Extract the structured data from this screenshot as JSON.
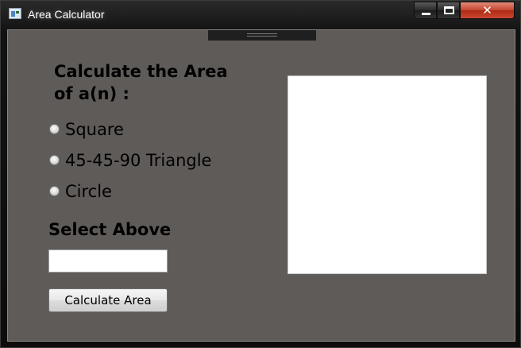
{
  "window": {
    "title": "Area Calculator",
    "close_glyph": "✕"
  },
  "main": {
    "heading": "Calculate the Area of a(n) :",
    "shape_options": [
      {
        "label": "Square",
        "selected": false
      },
      {
        "label": "45-45-90 Triangle",
        "selected": false
      },
      {
        "label": "Circle",
        "selected": false
      }
    ],
    "prompt": "Select Above",
    "input": {
      "value": "",
      "placeholder": ""
    },
    "calculate_label": "Calculate Area"
  },
  "colors": {
    "panel_bg": "#5f5b59",
    "canvas_bg": "#ffffff",
    "close_red": "#c4452f"
  }
}
